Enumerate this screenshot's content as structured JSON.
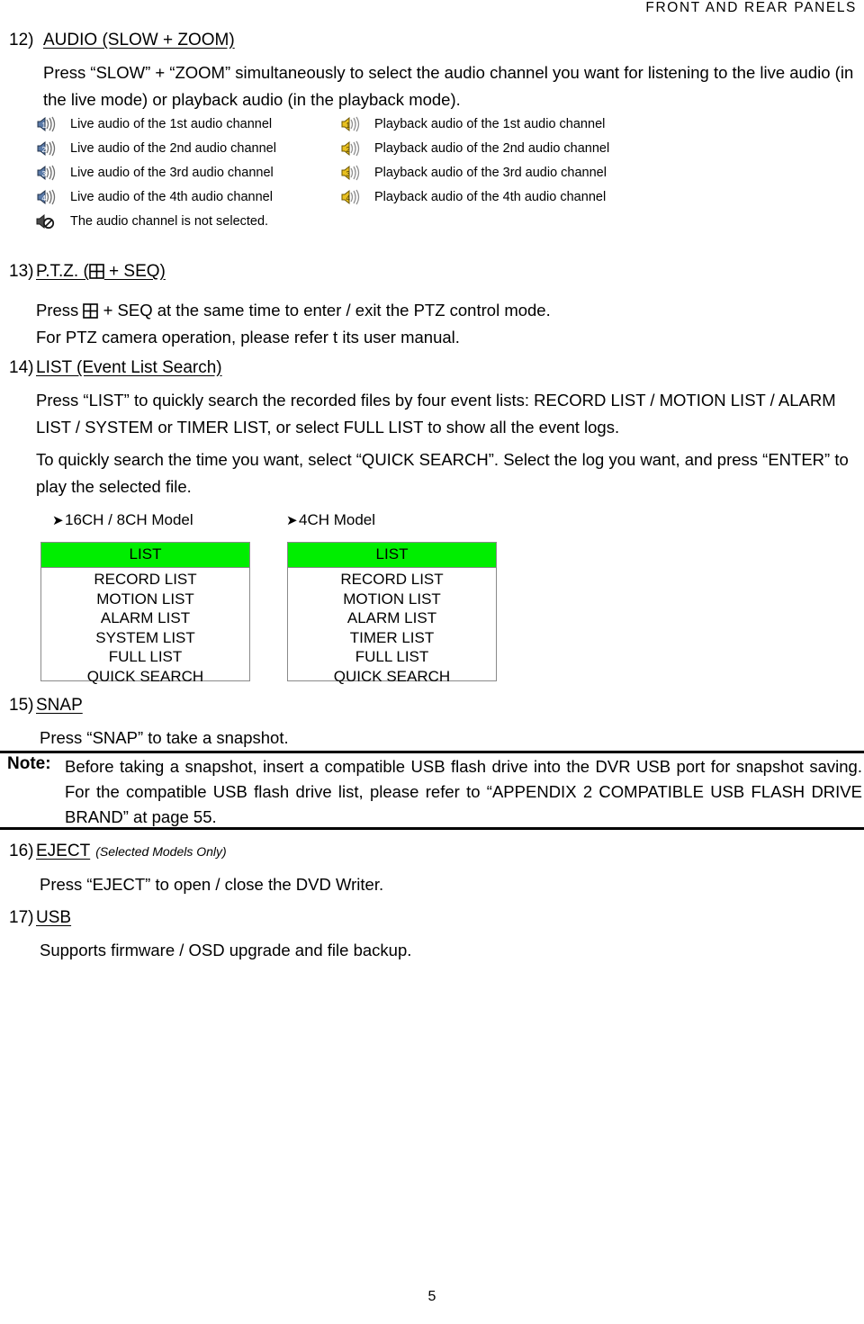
{
  "header": {
    "running_title": "FRONT AND REAR PANELS"
  },
  "sections": {
    "audio": {
      "number": "12)",
      "title": "AUDIO (SLOW + ZOOM)",
      "paragraph": "Press “SLOW” + “ZOOM” simultaneously to select the audio channel you want for listening to the live audio (in the live mode) or playback audio (in the playback mode).",
      "live_rows": [
        {
          "icon": "speaker-live-1-icon",
          "label": "Live audio of the 1st audio channel",
          "channel": "1"
        },
        {
          "icon": "speaker-live-2-icon",
          "label": "Live audio of the 2nd audio channel",
          "channel": "2"
        },
        {
          "icon": "speaker-live-3-icon",
          "label": "Live audio of the 3rd audio channel",
          "channel": "3"
        },
        {
          "icon": "speaker-live-4-icon",
          "label": "Live audio of the 4th audio channel",
          "channel": "4"
        },
        {
          "icon": "speaker-muted-icon",
          "label": "The audio channel is not selected.",
          "channel": ""
        }
      ],
      "playback_rows": [
        {
          "icon": "speaker-playback-1-icon",
          "label": "Playback audio of the 1st audio channel",
          "channel": "1"
        },
        {
          "icon": "speaker-playback-2-icon",
          "label": "Playback audio of the 2nd audio channel",
          "channel": "2"
        },
        {
          "icon": "speaker-playback-3-icon",
          "label": "Playback audio of the 3rd audio channel",
          "channel": "3"
        },
        {
          "icon": "speaker-playback-4-icon",
          "label": "Playback audio of the 4th audio channel",
          "channel": "4"
        }
      ]
    },
    "ptz": {
      "number": "13)",
      "title_before": "P.T.Z. (",
      "title_after": " + SEQ)",
      "line1_before": "Press",
      "line1_after": "+ SEQ at the same time to enter / exit the PTZ control mode.",
      "line2": "For PTZ camera operation, please refer t its user manual."
    },
    "list": {
      "number": "14)",
      "title": "LIST (Event List Search)",
      "paragraph1": "Press “LIST” to quickly search the recorded files by four event lists: RECORD LIST / MOTION LIST / ALARM LIST / SYSTEM or TIMER LIST, or select FULL LIST to show all the event logs.",
      "paragraph2": "To quickly search the time you want, select “QUICK SEARCH”. Select the log you want, and press “ENTER” to play the selected file.",
      "tables": [
        {
          "model_label": "16CH / 8CH Model",
          "header": "LIST",
          "items": [
            "RECORD LIST",
            "MOTION LIST",
            "ALARM LIST",
            "SYSTEM LIST",
            "FULL LIST",
            "QUICK SEARCH"
          ]
        },
        {
          "model_label": "4CH Model",
          "header": "LIST",
          "items": [
            "RECORD LIST",
            "MOTION LIST",
            "ALARM LIST",
            "TIMER LIST",
            "FULL LIST",
            "QUICK SEARCH"
          ]
        }
      ]
    },
    "snap": {
      "number": "15)",
      "title": "SNAP",
      "paragraph": "Press “SNAP” to take a snapshot."
    },
    "note": {
      "label": "Note:",
      "text": "Before taking a snapshot, insert a compatible USB flash drive into the DVR USB port for snapshot saving. For the compatible USB flash drive list, please refer to “APPENDIX 2 COMPATIBLE USB FLASH DRIVE BRAND” at page 55."
    },
    "eject": {
      "number": "16)",
      "title": "EJECT",
      "title_note": "(Selected Models Only)",
      "paragraph": "Press “EJECT” to open / close the DVD Writer."
    },
    "usb": {
      "number": "17)",
      "title": "USB",
      "paragraph": "Supports firmware / OSD upgrade and file backup."
    }
  },
  "footer": {
    "page_number": "5"
  },
  "colors": {
    "list_header_green": "#00ee00",
    "speaker_live": "#5a7aa8",
    "speaker_playback": "#e8c020",
    "table_border": "#8a8a8a",
    "text": "#000000"
  }
}
